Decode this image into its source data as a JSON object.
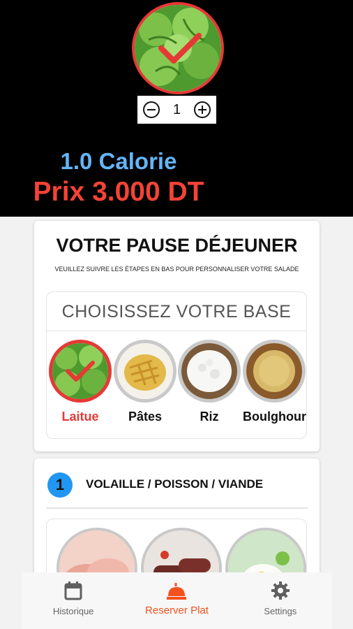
{
  "header": {
    "quantity": "1",
    "calorie": "1.0 Calorie",
    "price": "Prix 3.000 DT"
  },
  "main": {
    "title": "VOTRE PAUSE DÉJEUNER",
    "subtitle": "VEUILLEZ SUIVRE LES ÉTAPES EN BAS POUR PERSONNALISER VOTRE SALADE",
    "base_heading": "CHOISISSEZ VOTRE BASE",
    "bases": [
      {
        "label": "Laitue",
        "selected": true
      },
      {
        "label": "Pâtes",
        "selected": false
      },
      {
        "label": "Riz",
        "selected": false
      },
      {
        "label": "Boulghour",
        "selected": false
      }
    ]
  },
  "step1": {
    "number": "1",
    "title": "VOLAILLE / POISSON / VIANDE"
  },
  "nav": {
    "items": [
      {
        "label": "Historique",
        "icon": "calendar-icon",
        "active": false
      },
      {
        "label": "Reserver Plat",
        "icon": "food-tray-icon",
        "active": true
      },
      {
        "label": "Settings",
        "icon": "gear-icon",
        "active": false
      }
    ]
  },
  "colors": {
    "accent_red": "#e53935",
    "calorie_blue": "#64b5f6",
    "step_blue": "#2196f3",
    "nav_active": "#f4511e"
  }
}
